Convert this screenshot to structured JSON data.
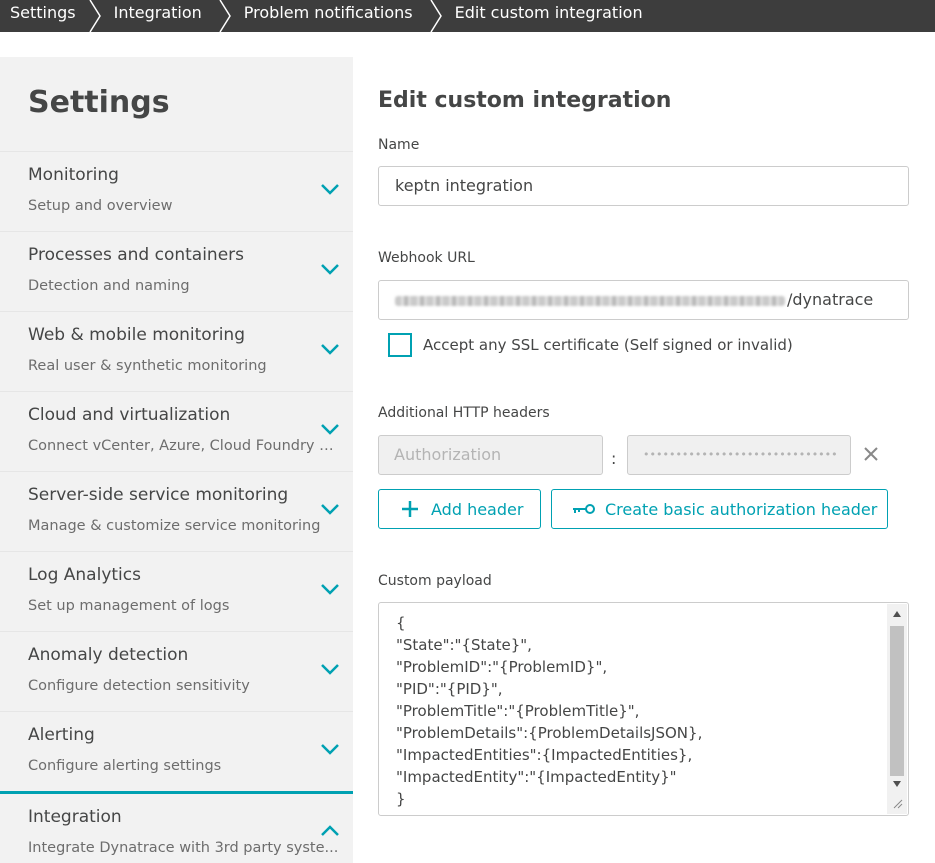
{
  "breadcrumb": {
    "items": [
      "Settings",
      "Integration",
      "Problem notifications",
      "Edit custom integration"
    ]
  },
  "sidebar": {
    "title": "Settings",
    "items": [
      {
        "label": "Monitoring",
        "sub": "Setup and overview",
        "expanded": false
      },
      {
        "label": "Processes and containers",
        "sub": "Detection and naming",
        "expanded": false
      },
      {
        "label": "Web & mobile monitoring",
        "sub": "Real user & synthetic monitoring",
        "expanded": false
      },
      {
        "label": "Cloud and virtualization",
        "sub": "Connect vCenter, Azure, Cloud Foundry o...",
        "expanded": false
      },
      {
        "label": "Server-side service monitoring",
        "sub": "Manage & customize service monitoring",
        "expanded": false
      },
      {
        "label": "Log Analytics",
        "sub": "Set up management of logs",
        "expanded": false
      },
      {
        "label": "Anomaly detection",
        "sub": "Configure detection sensitivity",
        "expanded": false
      },
      {
        "label": "Alerting",
        "sub": "Configure alerting settings",
        "expanded": false
      },
      {
        "label": "Integration",
        "sub": "Integrate Dynatrace with 3rd party syste...",
        "expanded": true
      }
    ]
  },
  "main": {
    "title": "Edit custom integration",
    "name_label": "Name",
    "name_value": "keptn integration",
    "webhook_label": "Webhook URL",
    "webhook_visible_suffix": "/dynatrace",
    "ssl_label": "Accept any SSL certificate (Self signed or invalid)",
    "ssl_checked": false,
    "headers_label": "Additional HTTP headers",
    "header_name_placeholder": "Authorization",
    "header_value_masked": "••••••••••••••••••••••••••••••",
    "header_separator": ":",
    "add_header_label": "Add header",
    "basic_auth_label": "Create basic authorization header",
    "payload_label": "Custom payload",
    "payload_lines": [
      "{",
      "\"State\":\"{State}\",",
      "\"ProblemID\":\"{ProblemID}\",",
      "\"PID\":\"{PID}\",",
      "\"ProblemTitle\":\"{ProblemTitle}\",",
      "\"ProblemDetails\":{ProblemDetailsJSON},",
      "\"ImpactedEntities\":{ImpactedEntities},",
      "\"ImpactedEntity\":\"{ImpactedEntity}\"",
      "}"
    ]
  },
  "colors": {
    "accent": "#00a1b2",
    "breadcrumb_bg": "#3d3d3d",
    "sidebar_bg": "#f2f2f2",
    "text": "#454646"
  }
}
